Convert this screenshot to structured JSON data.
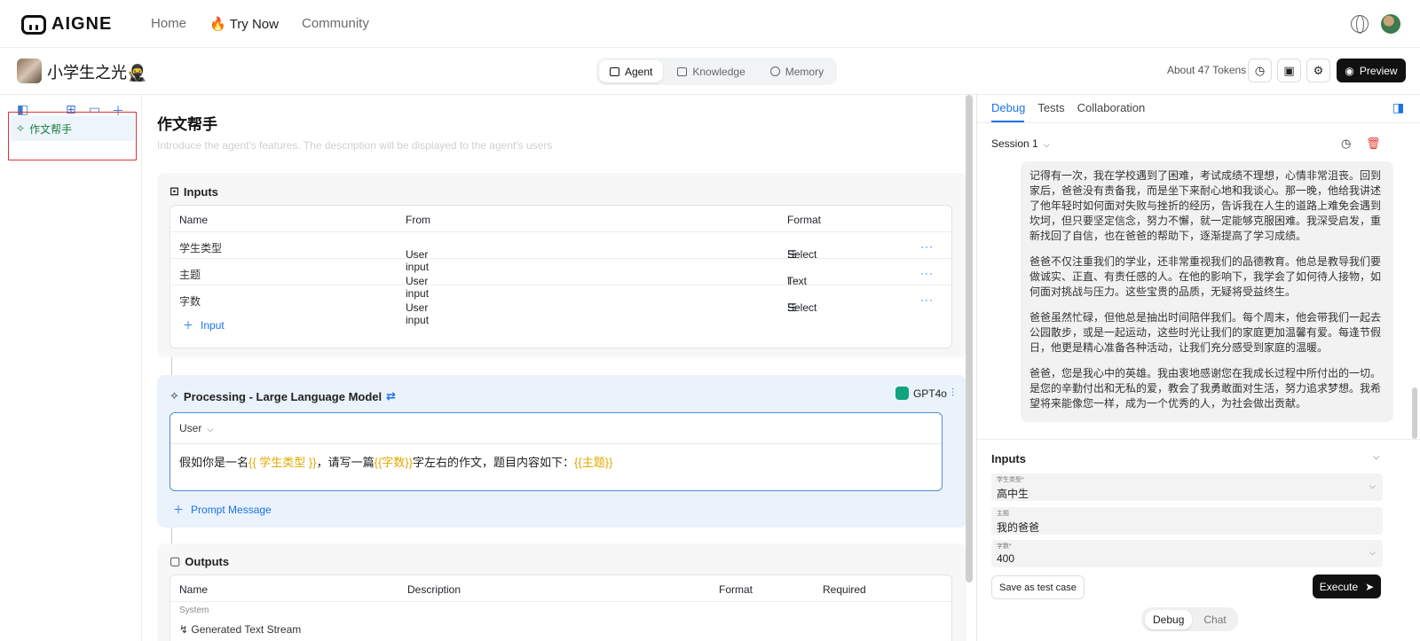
{
  "nav": {
    "logo_text": "AIGNE",
    "home": "Home",
    "try_now": "Try Now",
    "community": "Community"
  },
  "app": {
    "title": "小学生之光🥷",
    "tokens": "About 47 Tokens",
    "preview": "Preview"
  },
  "tabs": {
    "agent": "Agent",
    "knowledge": "Knowledge",
    "memory": "Memory"
  },
  "sidebar": {
    "item": "作文帮手"
  },
  "agent": {
    "name": "作文帮手",
    "description_placeholder": "Introduce the agent's features. The description will be displayed to the agent's users"
  },
  "inputs_card": {
    "title": "Inputs",
    "headers": {
      "name": "Name",
      "from": "From",
      "format": "Format"
    },
    "rows": [
      {
        "name": "学生类型",
        "from": "User input",
        "format": "Select"
      },
      {
        "name": "主题",
        "from": "User input",
        "format": "Text"
      },
      {
        "name": "字数",
        "from": "User input",
        "format": "Select"
      }
    ],
    "add": "Input"
  },
  "processing": {
    "title": "Processing -  Large Language Model",
    "model": "GPT4o",
    "role": "User",
    "prompt": {
      "p1": "假如你是一名",
      "v1": "{{ 学生类型 }}",
      "p2": "，请写一篇",
      "v2": "{{字数}}",
      "p3": "字左右的作文，题目内容如下：",
      "v3": "{{主题}}"
    },
    "add": "Prompt Message"
  },
  "outputs_card": {
    "title": "Outputs",
    "headers": {
      "name": "Name",
      "description": "Description",
      "format": "Format",
      "required": "Required"
    },
    "system_label": "System",
    "row1": "Generated Text Stream"
  },
  "right": {
    "tabs": {
      "debug": "Debug",
      "tests": "Tests",
      "collaboration": "Collaboration"
    },
    "session": "Session 1",
    "chat": [
      "记得有一次，我在学校遇到了困难，考试成绩不理想，心情非常沮丧。回到家后，爸爸没有责备我，而是坐下来耐心地和我谈心。那一晚，他给我讲述了他年轻时如何面对失败与挫折的经历，告诉我在人生的道路上难免会遇到坎坷，但只要坚定信念，努力不懈，就一定能够克服困难。我深受启发，重新找回了自信，也在爸爸的帮助下，逐渐提高了学习成绩。",
      "爸爸不仅注重我们的学业，还非常重视我们的品德教育。他总是教导我们要做诚实、正直、有责任感的人。在他的影响下，我学会了如何待人接物，如何面对挑战与压力。这些宝贵的品质，无疑将受益终生。",
      "爸爸虽然忙碌，但他总是抽出时间陪伴我们。每个周末，他会带我们一起去公园散步，或是一起运动，这些时光让我们的家庭更加温馨有爱。每逢节假日，他更是精心准备各种活动，让我们充分感受到家庭的温暖。",
      "爸爸，您是我心中的英雄。我由衷地感谢您在我成长过程中所付出的一切。是您的辛勤付出和无私的爱，教会了我勇敢面对生活，努力追求梦想。我希望将来能像您一样，成为一个优秀的人，为社会做出贡献。"
    ],
    "inputs_title": "Inputs",
    "fields": [
      {
        "label": "学生类型*",
        "value": "高中生"
      },
      {
        "label": "主题",
        "value": "我的爸爸"
      },
      {
        "label": "字数*",
        "value": "400"
      }
    ],
    "save_test": "Save as test case",
    "execute": "Execute",
    "mode": {
      "debug": "Debug",
      "chat": "Chat"
    }
  }
}
